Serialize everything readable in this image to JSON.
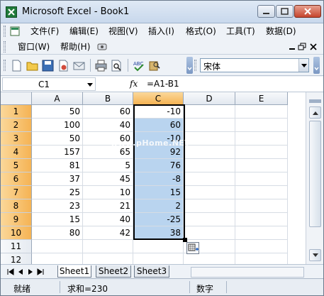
{
  "window": {
    "title": "Microsoft Excel - Book1"
  },
  "menu": {
    "items": [
      "文件(F)",
      "编辑(E)",
      "视图(V)",
      "插入(I)",
      "格式(O)",
      "工具(T)",
      "数据(D)"
    ],
    "items2": [
      "窗口(W)",
      "帮助(H)"
    ]
  },
  "toolbar": {
    "font_name": "宋体"
  },
  "formula_bar": {
    "name_box": "C1",
    "fx": "fx",
    "formula": "=A1-B1"
  },
  "grid": {
    "columns": [
      "A",
      "B",
      "C",
      "D",
      "E"
    ],
    "selected_column": "C",
    "rows": [
      {
        "num": "1",
        "A": "50",
        "B": "60",
        "C": "-10"
      },
      {
        "num": "2",
        "A": "100",
        "B": "40",
        "C": "60"
      },
      {
        "num": "3",
        "A": "50",
        "B": "60",
        "C": "-10"
      },
      {
        "num": "4",
        "A": "157",
        "B": "65",
        "C": "92"
      },
      {
        "num": "5",
        "A": "81",
        "B": "5",
        "C": "76"
      },
      {
        "num": "6",
        "A": "37",
        "B": "45",
        "C": "-8"
      },
      {
        "num": "7",
        "A": "25",
        "B": "10",
        "C": "15"
      },
      {
        "num": "8",
        "A": "23",
        "B": "21",
        "C": "2"
      },
      {
        "num": "9",
        "A": "15",
        "B": "40",
        "C": "-25"
      },
      {
        "num": "10",
        "A": "80",
        "B": "42",
        "C": "38"
      },
      {
        "num": "11",
        "A": "",
        "B": "",
        "C": ""
      },
      {
        "num": "12",
        "A": "",
        "B": "",
        "C": ""
      }
    ],
    "watermark": "www.pHome.NET"
  },
  "sheets": [
    "Sheet1",
    "Sheet2",
    "Sheet3"
  ],
  "active_sheet": "Sheet1",
  "status": {
    "ready": "就绪",
    "sum": "求和=230",
    "numlock": "数字"
  },
  "colors": {
    "selected_header": "#f5b354",
    "selection_fill": "#b9d4ef"
  }
}
